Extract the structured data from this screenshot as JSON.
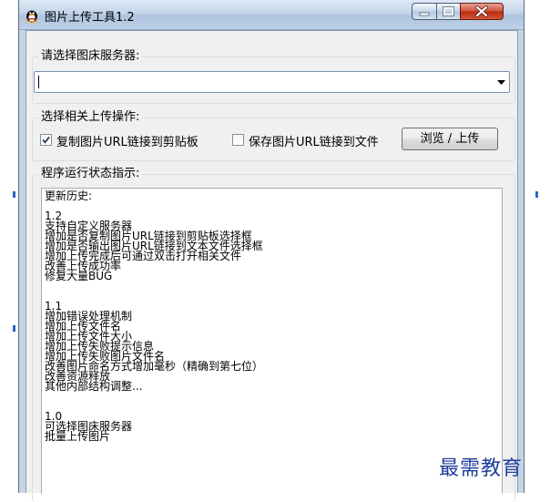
{
  "window": {
    "title": "图片上传工具1.2",
    "icon": "penguin-icon"
  },
  "server": {
    "label": "请选择图床服务器:",
    "value": ""
  },
  "upload": {
    "label": "选择相关上传操作:",
    "copy_label": "复制图片URL链接到剪贴板",
    "copy_checked": true,
    "save_label": "保存图片URL链接到文件",
    "save_checked": false,
    "browse_label": "浏览 / 上传"
  },
  "status": {
    "label": "程序运行状态指示:",
    "lines": [
      "更新历史:",
      "",
      "1.2",
      "支持自定义服务器",
      "增加是否复制图片URL链接到剪贴板选择框",
      "增加是否输出图片URL链接到文本文件选择框",
      "增加上传完成后可通过双击打开相关文件",
      "改善上传成功率",
      "修复大量BUG",
      "",
      "",
      "1.1",
      "增加错误处理机制",
      "增加上传文件名",
      "增加上传文件大小",
      "增加上传失败提示信息",
      "增加上传失败图片文件名",
      "改善图片命名方式增加毫秒（精确到第七位）",
      "改善资源释放",
      "其他内部结构调整...",
      "",
      "",
      "1.0",
      "可选择图床服务器",
      "批量上传图片"
    ]
  },
  "watermark": "最需教育",
  "colors": {
    "titlebar": "#c3d4ea",
    "close": "#c83a1f",
    "accent": "#2b63c4",
    "watermark": "#1d3f9c"
  }
}
